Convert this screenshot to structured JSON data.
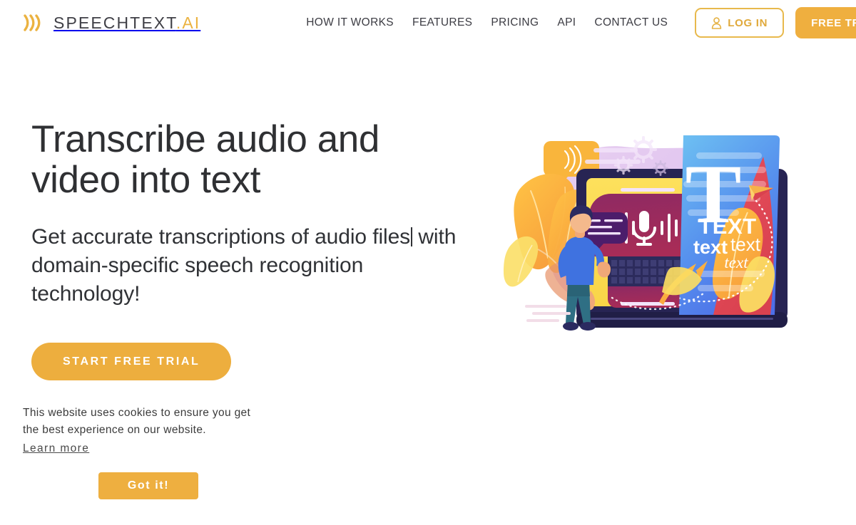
{
  "header": {
    "logo": {
      "icon": "sound-wave-icon",
      "name_main": "SPEECHTEXT",
      "name_suffix": ".AI"
    },
    "nav": [
      {
        "label": "HOW IT WORKS",
        "name": "nav-how-it-works"
      },
      {
        "label": "FEATURES",
        "name": "nav-features"
      },
      {
        "label": "PRICING",
        "name": "nav-pricing"
      },
      {
        "label": "API",
        "name": "nav-api"
      },
      {
        "label": "CONTACT US",
        "name": "nav-contact-us"
      }
    ],
    "login_label": "LOG IN",
    "login_icon": "user-account-icon",
    "free_trial_label": "FREE TRIAL"
  },
  "hero": {
    "title": "Transcribe audio and video into text",
    "subtitle_typed": "Get accurate transcriptions of audio files",
    "subtitle_rest": "with domain-specific speech recognition technology!",
    "cta_label": "START FREE TRIAL",
    "illustration": {
      "name": "speech-to-text-illustration",
      "text_labels": [
        "T",
        "TEXT",
        "text",
        "text",
        "text"
      ],
      "icons": [
        "microphone-icon",
        "sound-wave-bars",
        "gear-icon",
        "paper-plane-icon",
        "speech-bubble-icon",
        "person-figure"
      ]
    }
  },
  "cookie_consent": {
    "message": "This website uses cookies to ensure you get the best experience on our website.",
    "learn_more_label": "Learn more",
    "accept_label": "Got it!"
  },
  "colors": {
    "brand_gold": "#EBB240",
    "button_amber": "#EFAF3F",
    "text_dark": "#2f3033",
    "page_background": "#ffffff"
  }
}
